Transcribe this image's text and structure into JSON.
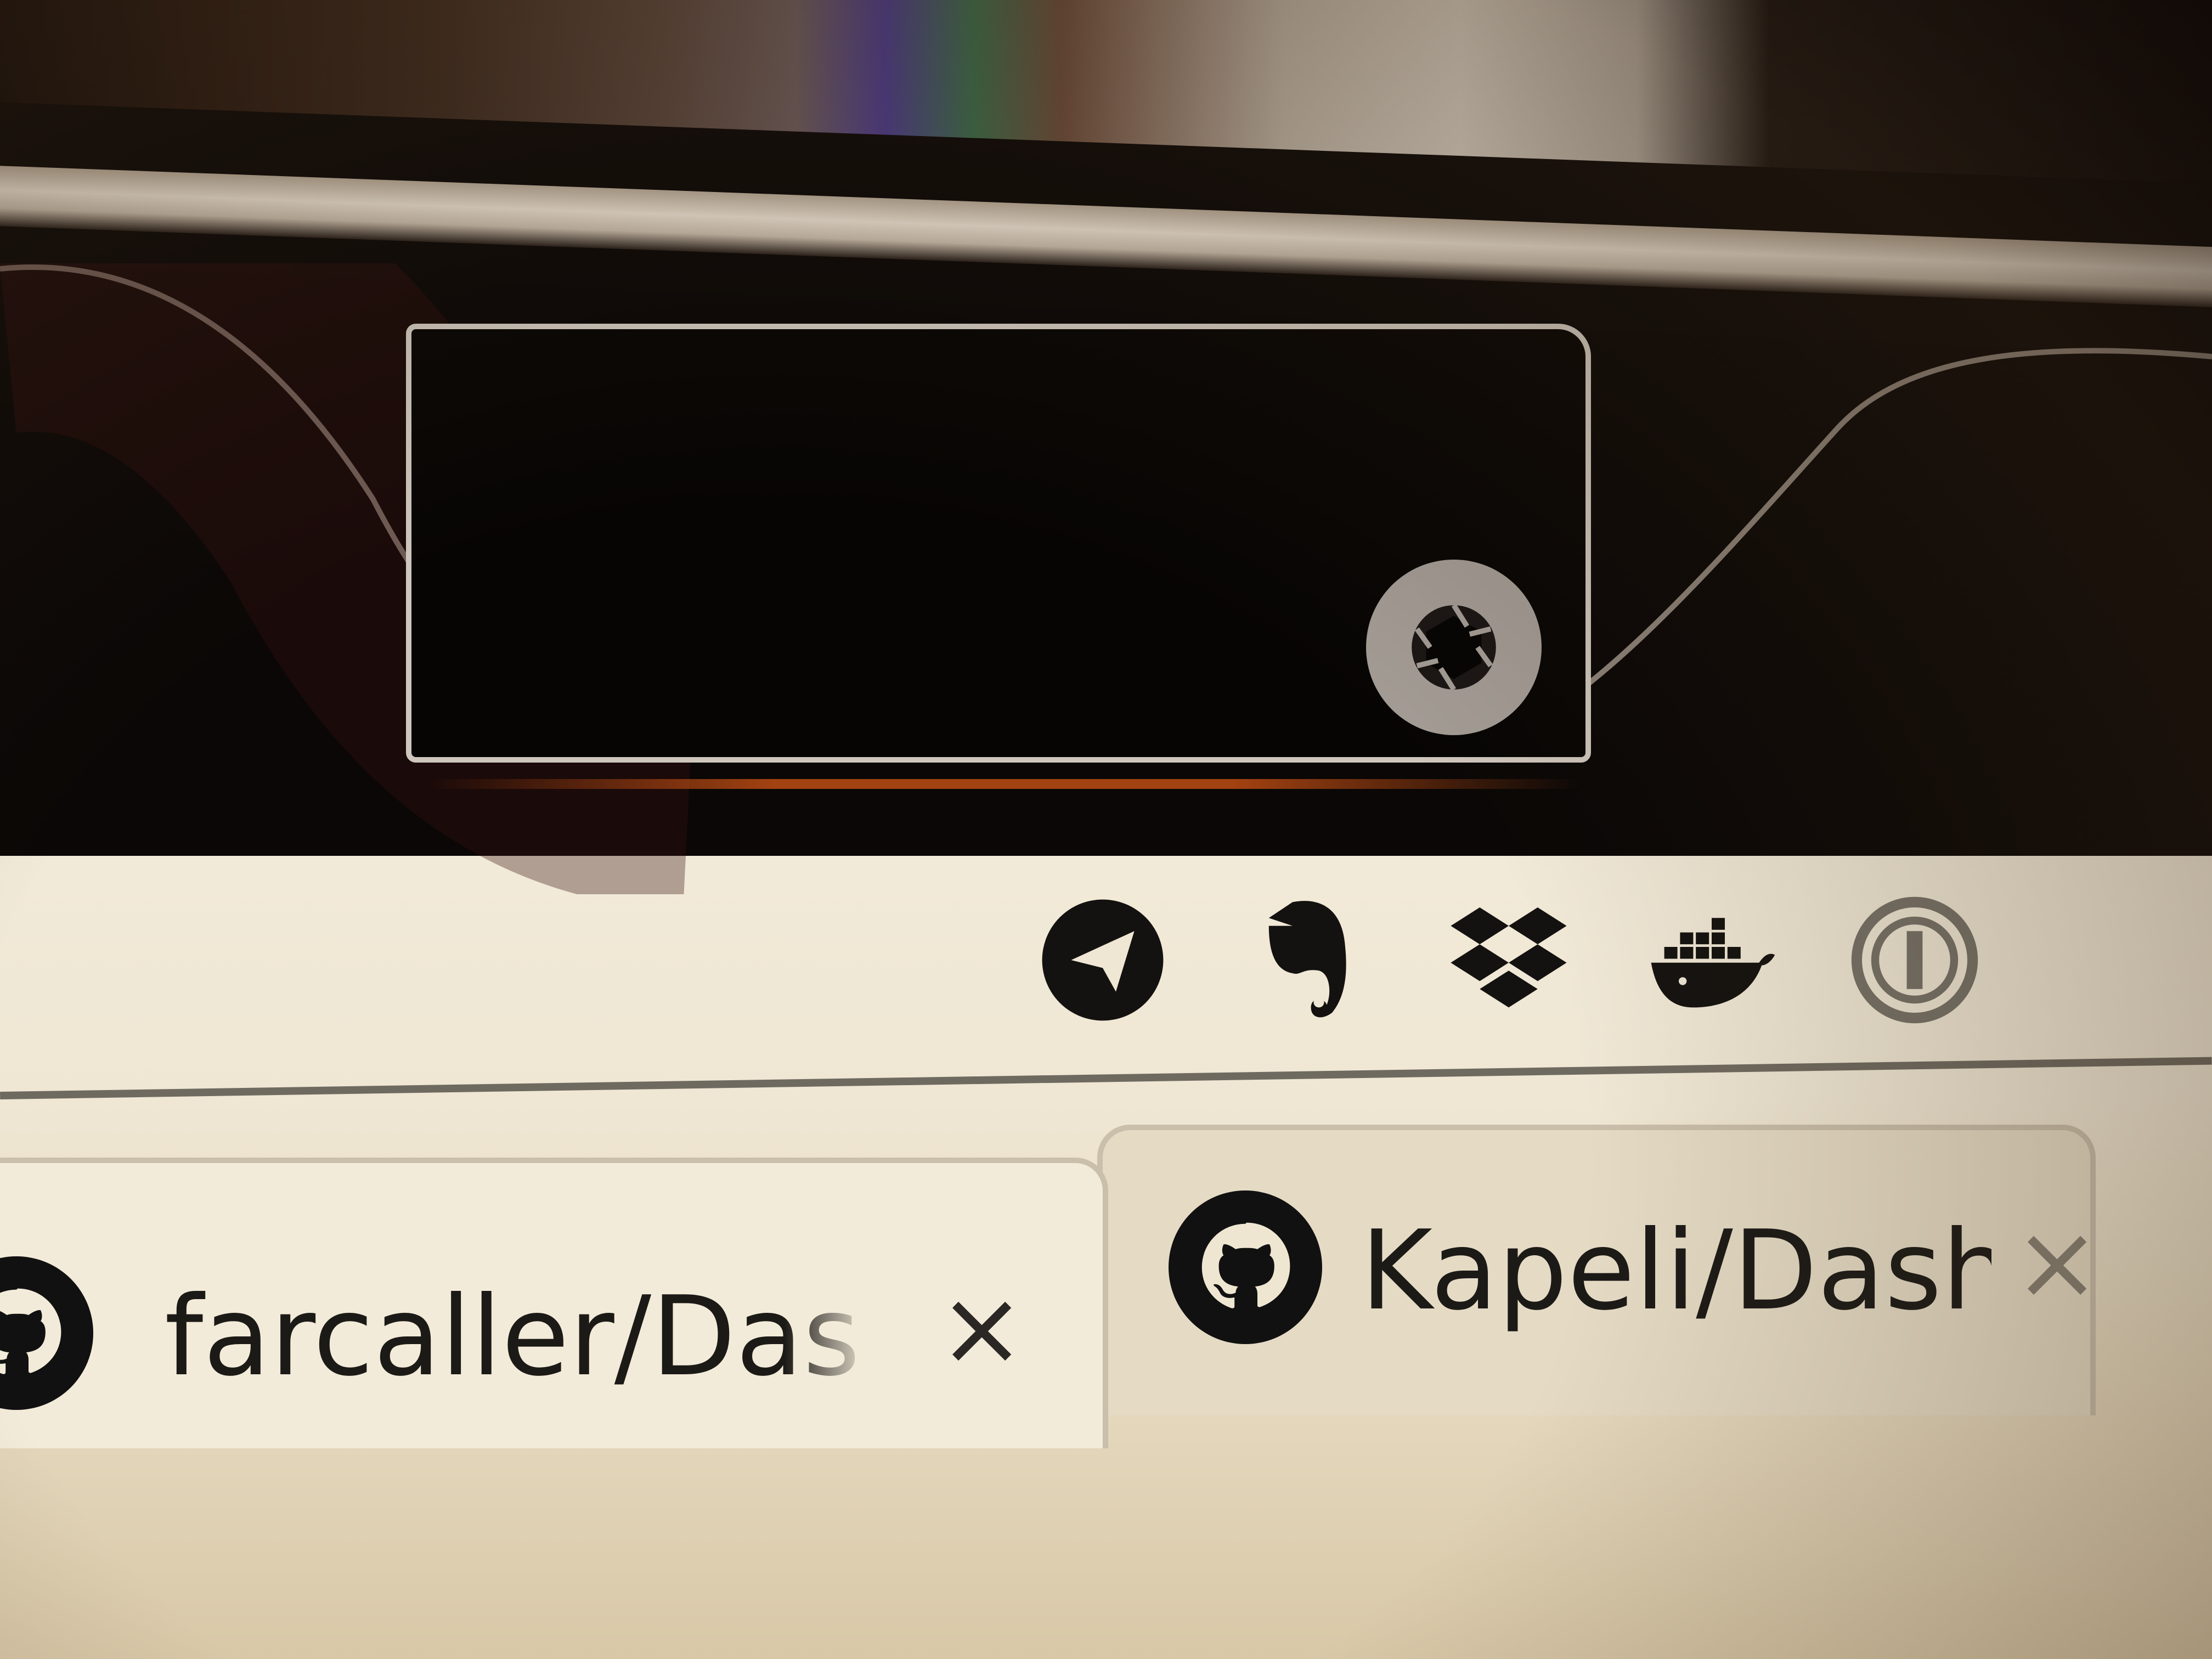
{
  "menubar": {
    "status_icons": [
      {
        "name": "telegram-icon"
      },
      {
        "name": "evernote-icon"
      },
      {
        "name": "dropbox-icon"
      },
      {
        "name": "docker-icon"
      },
      {
        "name": "1password-icon"
      }
    ]
  },
  "tabs": [
    {
      "label": "farcaller/Dash",
      "close_label": "×",
      "icon": "github-icon",
      "active": true
    },
    {
      "label": "Kapeli/Dash-",
      "close_label": "×",
      "icon": "github-icon",
      "active": false
    }
  ],
  "colors": {
    "screen_bg": "#f2ead8",
    "menubar_bg": "#0b0807",
    "notch_border": "#cfc7bd"
  }
}
